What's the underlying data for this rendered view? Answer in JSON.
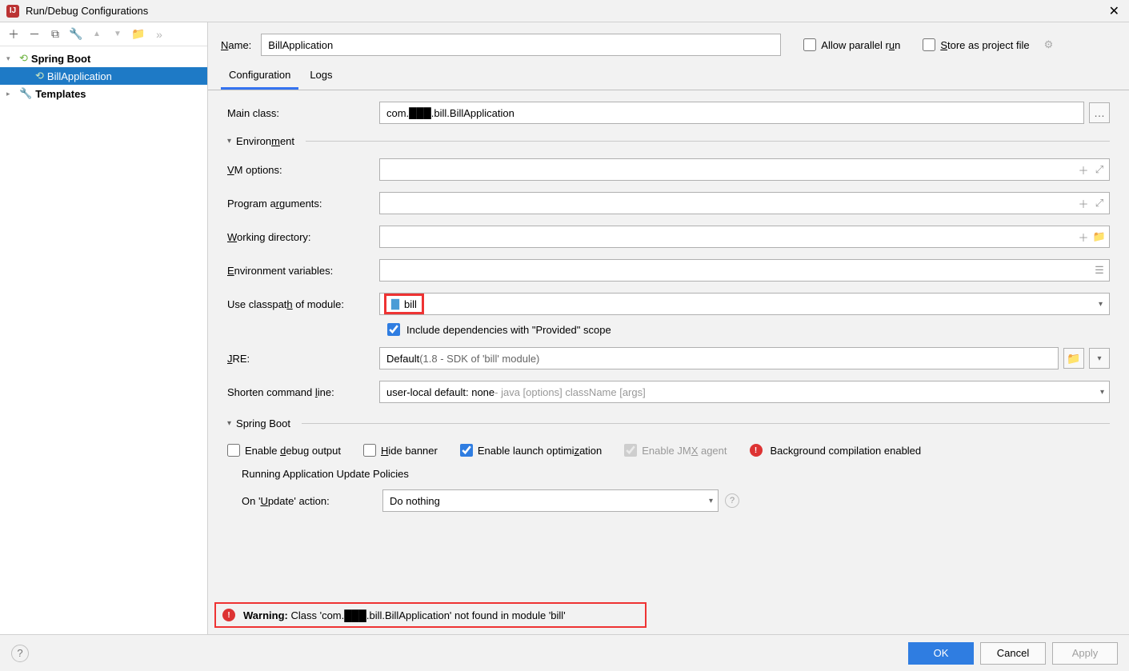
{
  "window": {
    "title": "Run/Debug Configurations"
  },
  "tree": {
    "nodes": [
      {
        "label": "Spring Boot",
        "bold": true,
        "icon": "spring"
      },
      {
        "label": "BillApplication",
        "icon": "spring",
        "selected": true
      },
      {
        "label": "Templates",
        "bold": true,
        "icon": "wrench"
      }
    ]
  },
  "header": {
    "name_label": "Name:",
    "name_value": "BillApplication",
    "allow_parallel": "Allow parallel run",
    "store_as_project": "Store as project file"
  },
  "tabs": {
    "configuration": "Configuration",
    "logs": "Logs"
  },
  "form": {
    "main_class_label": "Main class:",
    "main_class_value": "com.███.bill.BillApplication",
    "env_section": "Environment",
    "vm_options_label": "VM options:",
    "vm_options_value": "",
    "program_args_label": "Program arguments:",
    "program_args_value": "",
    "working_dir_label": "Working directory:",
    "working_dir_value": "",
    "env_vars_label": "Environment variables:",
    "env_vars_value": "",
    "classpath_label": "Use classpath of module:",
    "classpath_value": "bill",
    "include_provided": "Include dependencies with \"Provided\" scope",
    "jre_label": "JRE:",
    "jre_prefix": "Default",
    "jre_hint": " (1.8 - SDK of 'bill' module)",
    "shorten_label": "Shorten command line:",
    "shorten_prefix": "user-local default: none",
    "shorten_hint": " - java [options] className [args]",
    "sb_section": "Spring Boot",
    "sb_debug": "Enable debug output",
    "sb_hide_banner": "Hide banner",
    "sb_launch_opt": "Enable launch optimization",
    "sb_jmx": "Enable JMX agent",
    "sb_bg_compile": "Background compilation enabled",
    "update_policies": "Running Application Update Policies",
    "on_update_label": "On 'Update' action:",
    "on_update_value": "Do nothing"
  },
  "warning": {
    "prefix": "Warning:",
    "text": "Class 'com.███.bill.BillApplication' not found in module 'bill'"
  },
  "buttons": {
    "ok": "OK",
    "cancel": "Cancel",
    "apply": "Apply"
  }
}
